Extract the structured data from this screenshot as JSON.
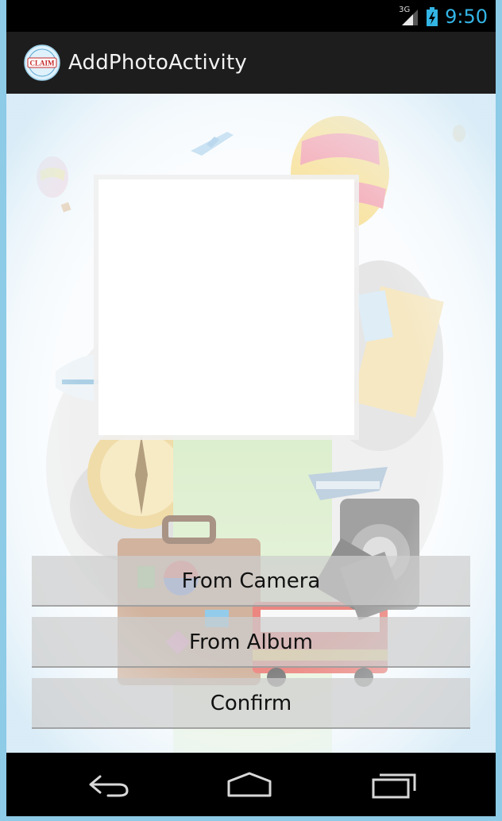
{
  "status_bar": {
    "network": "3G",
    "time": "9:50",
    "colors": {
      "clock": "#33b5e5",
      "battery": "#33b5e5"
    }
  },
  "action_bar": {
    "title": "AddPhotoActivity",
    "logo_text": "CLAIM"
  },
  "main": {
    "buttons": {
      "camera": "From Camera",
      "album": "From Album",
      "confirm": "Confirm"
    }
  },
  "nav_bar": {
    "icons": [
      "back-icon",
      "home-icon",
      "recent-apps-icon"
    ]
  }
}
